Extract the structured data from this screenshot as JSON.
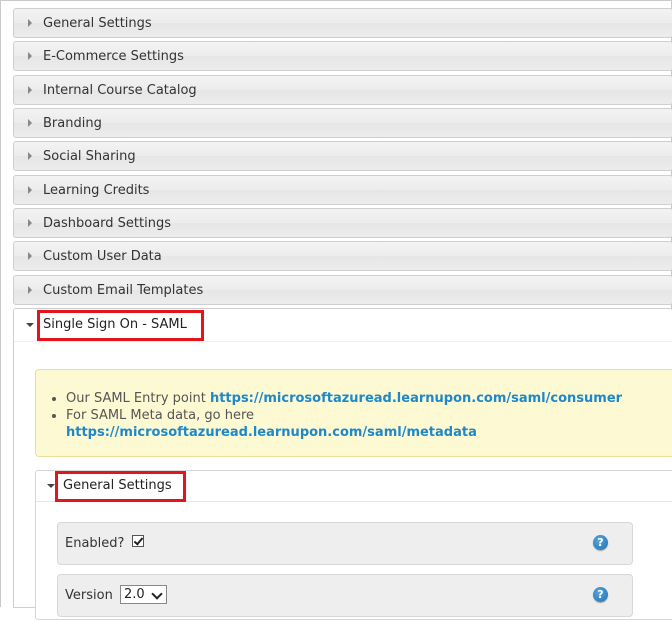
{
  "accordion": {
    "collapsed_sections": [
      {
        "label": "General Settings"
      },
      {
        "label": "E-Commerce Settings"
      },
      {
        "label": "Internal Course Catalog"
      },
      {
        "label": "Branding"
      },
      {
        "label": "Social Sharing"
      },
      {
        "label": "Learning Credits"
      },
      {
        "label": "Dashboard Settings"
      },
      {
        "label": "Custom User Data"
      },
      {
        "label": "Custom Email Templates"
      }
    ],
    "open_section": {
      "label": "Single Sign On - SAML",
      "info": {
        "entry_point_text": "Our SAML Entry point",
        "entry_point_url": "https://microsoftazuread.learnupon.com/saml/consumer",
        "metadata_text": "For SAML Meta data, go here",
        "metadata_url": "https://microsoftazuread.learnupon.com/saml/metadata"
      },
      "sub_section": {
        "label": "General Settings",
        "fields": {
          "enabled": {
            "label": "Enabled?",
            "checked": true,
            "help": "?"
          },
          "version": {
            "label": "Version",
            "value": "2.0",
            "help": "?"
          }
        }
      }
    }
  },
  "colors": {
    "highlight": "#e3141c",
    "link": "#1e88c8",
    "info_bg": "#fdf9d3"
  }
}
